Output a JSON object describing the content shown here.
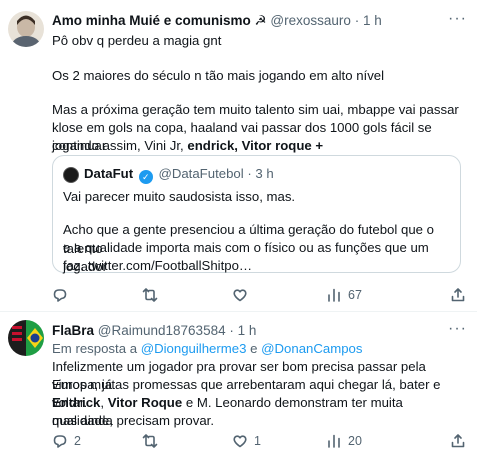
{
  "tweet1": {
    "display_name": "Amo minha Muié e comunismo",
    "emoji": "☭",
    "handle": "@rexossauro",
    "dot": "·",
    "time": "1 h",
    "more": "···",
    "lines": [
      "Pô obv q perdeu a magia gnt",
      "Os 2 maiores do século n tão mais jogando em alto nível",
      "Mas a próxima geração tem muito talento sim uai, mbappe vai passar",
      "klose em gols na copa, haaland vai passar dos 1000 gols fácil se continuar"
    ],
    "last_line_prefix": "jogando assim, Vini Jr, ",
    "last_line_bold": "endrick, Vitor roque +",
    "quote": {
      "display_name": "DataFut",
      "verified_mark": "✓",
      "handle": "@DataFutebol",
      "dot": "·",
      "time": "3 h",
      "text_1": "Vai parecer muito saudosista isso, mas.",
      "text_2a": "Acho que a gente presenciou a última geração do futebol que o talento",
      "text_2b": "e a qualidade importa mais com o físico ou as funções que um jogador",
      "text_2c": "faz. twitter.com/FootballShitpo…"
    },
    "actions": {
      "reply": "",
      "retweet": "",
      "like": "",
      "views": "67"
    }
  },
  "tweet2": {
    "display_name": "FlaBra",
    "handle": "@Raimund18763584",
    "dot": "·",
    "time": "1 h",
    "more": "···",
    "reply_prefix": "Em resposta a ",
    "reply_user1": "@Dionguilherme3",
    "reply_and": " e ",
    "reply_user2": "@DonanCampos",
    "line1": "Infelizmente um jogador pra provar ser bom precisa passar pela Europa, já",
    "line2": "vimos muitas promessas que arrebentaram aqui chegar lá, bater e voltar.",
    "line3_bold1": "Endrick",
    "line3_sep": ", ",
    "line3_bold2": "Vitor Roque",
    "line3_rest": " e M. Leonardo demonstram ter muita qualidade,",
    "line4": "mas ainda precisam provar.",
    "actions": {
      "reply": "2",
      "retweet": "",
      "like": "1",
      "views": "20"
    }
  }
}
